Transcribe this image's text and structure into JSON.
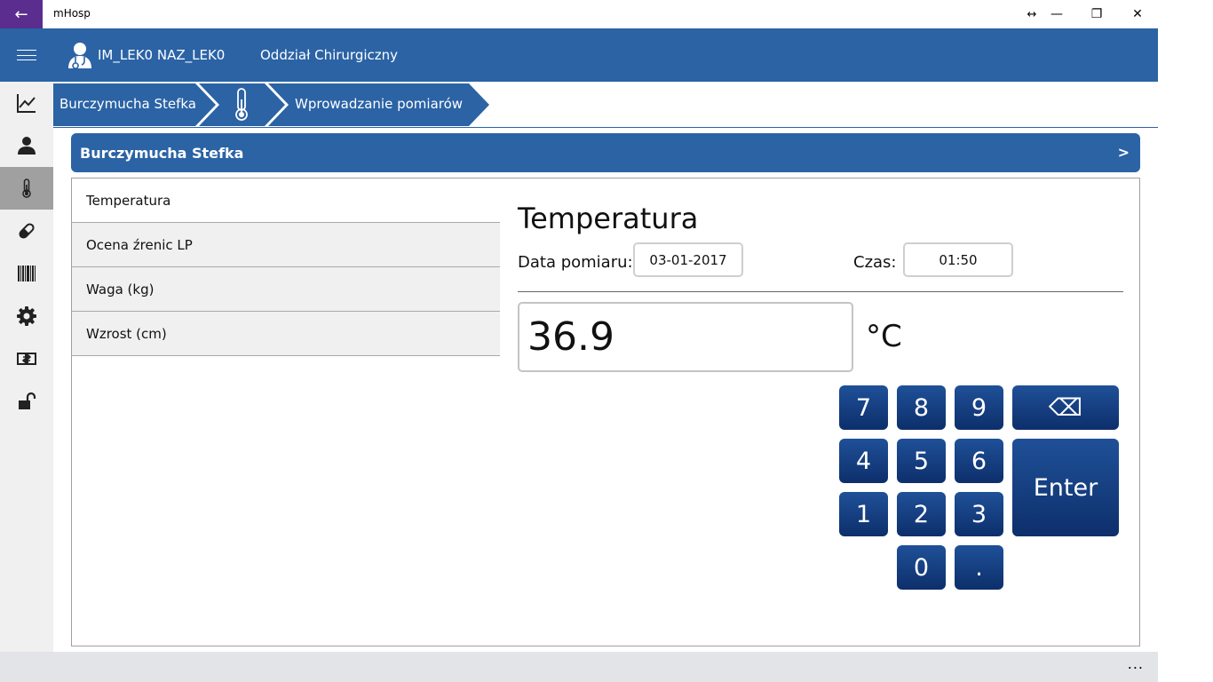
{
  "window": {
    "title": "mHosp",
    "back_glyph": "←",
    "resize_glyph": "↔",
    "minimize_glyph": "—",
    "restore_glyph": "❐",
    "close_glyph": "✕"
  },
  "header": {
    "user": "IM_LEK0 NAZ_LEK0",
    "department": "Oddział Chirurgiczny"
  },
  "nav": {
    "items": [
      {
        "icon": "chart-icon"
      },
      {
        "icon": "person-icon"
      },
      {
        "icon": "thermometer-icon",
        "active": true
      },
      {
        "icon": "pill-icon"
      },
      {
        "icon": "barcode-icon"
      },
      {
        "icon": "gear-icon"
      },
      {
        "icon": "switch-icon"
      },
      {
        "icon": "unlock-icon"
      }
    ]
  },
  "breadcrumb": {
    "patient": "Burczymucha Stefka",
    "section_icon": "thermometer-icon",
    "page": "Wprowadzanie pomiarów"
  },
  "patient_bar": {
    "name": "Burczymucha Stefka",
    "next": ">"
  },
  "measurements": {
    "items": [
      {
        "label": "Temperatura"
      },
      {
        "label": "Ocena źrenic LP"
      },
      {
        "label": "Waga (kg)"
      },
      {
        "label": "Wzrost (cm)"
      }
    ]
  },
  "panel": {
    "title": "Temperatura",
    "date_label": "Data pomiaru:",
    "date_value": "03-01-2017",
    "time_label": "Czas:",
    "time_value": "01:50",
    "value": "36.9",
    "unit": "°C"
  },
  "keypad": {
    "k7": "7",
    "k8": "8",
    "k9": "9",
    "k4": "4",
    "k5": "5",
    "k6": "6",
    "k1": "1",
    "k2": "2",
    "k3": "3",
    "k0": "0",
    "kdot": ".",
    "backspace": "⌫",
    "enter": "Enter"
  },
  "bottom": {
    "more": "..."
  },
  "colors": {
    "primary": "#2b63a5",
    "key_top": "#1f5098",
    "key_bottom": "#0d2f6b",
    "title_back": "#5b2d8e"
  }
}
